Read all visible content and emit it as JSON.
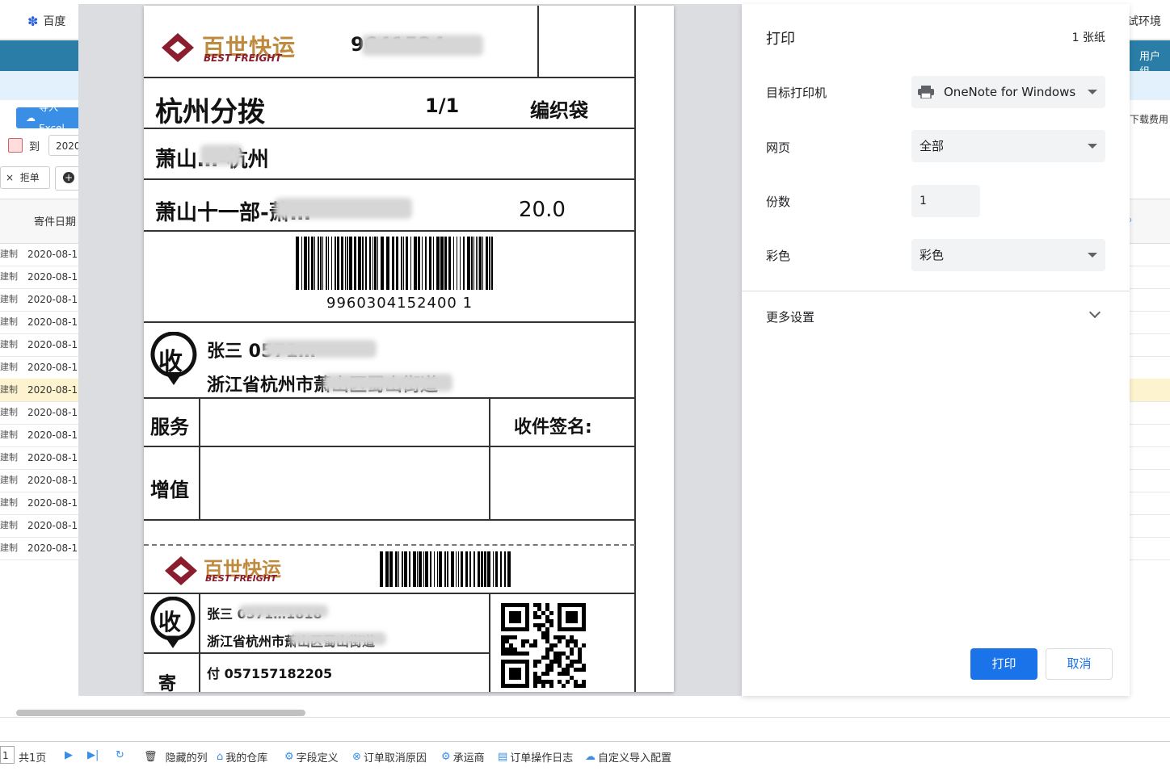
{
  "background_app": {
    "tab_left": "百度",
    "tab_right": "试环境",
    "banner_user": "用户组",
    "import_button": "导入Excel",
    "date_to": "到",
    "date_value": "2020",
    "reject_button": "拒单",
    "right_link": "下载费用",
    "column_title": "寄件日期",
    "rows": [
      {
        "tag": "建制",
        "date": "2020-08-12"
      },
      {
        "tag": "建制",
        "date": "2020-08-12"
      },
      {
        "tag": "建制",
        "date": "2020-08-12"
      },
      {
        "tag": "建制",
        "date": "2020-08-12"
      },
      {
        "tag": "建制",
        "date": "2020-08-12"
      },
      {
        "tag": "建制",
        "date": "2020-08-12"
      },
      {
        "tag": "建制",
        "date": "2020-08-12"
      },
      {
        "tag": "建制",
        "date": "2020-08-12"
      },
      {
        "tag": "建制",
        "date": "2020-08-12"
      },
      {
        "tag": "建制",
        "date": "2020-08-12"
      },
      {
        "tag": "建制",
        "date": "2020-08-12"
      },
      {
        "tag": "建制",
        "date": "2020-08-12"
      },
      {
        "tag": "建制",
        "date": "2020-08-12"
      },
      {
        "tag": "建制",
        "date": "2020-08-12"
      }
    ],
    "highlighted_row_index": 6,
    "bottom_bar": {
      "page_input": "1",
      "total_pages": "共1页",
      "items": [
        "隐藏的列",
        "我的仓库",
        "字段定义",
        "订单取消原因",
        "承运商",
        "订单操作日志",
        "自定义导入配置"
      ]
    }
  },
  "label": {
    "brand_cn": "百世快运",
    "brand_en": "BEST FREIGHT",
    "tracking_top": "9641524",
    "hub": "杭州分拨",
    "piece": "1/1",
    "packaging": "编织袋",
    "route": "萧山…-杭州",
    "dept_line": "萧山十一部-萧…",
    "weight": "20.0",
    "barcode_number": "9960304152400 1",
    "receiver_badge": "收",
    "receiver_name": "张三 0571…",
    "receiver_address": "浙江省杭州市萧山区蜀山街道",
    "service_label": "服务",
    "signature_label": "收件签名:",
    "value_added_label": "增值",
    "receiver_name_small": "张三 0571…1818",
    "receiver_address_small": "浙江省杭州市萧山区蜀山街道",
    "sender_badge": "寄",
    "sender_phone": "付 057157182205"
  },
  "print_dialog": {
    "title": "打印",
    "sheets": "1 张纸",
    "printer_label": "目标打印机",
    "printer_value": "OneNote for Windows",
    "pages_label": "网页",
    "pages_value": "全部",
    "copies_label": "份数",
    "copies_value": "1",
    "color_label": "彩色",
    "color_value": "彩色",
    "more_settings": "更多设置",
    "print_button": "打印",
    "cancel_button": "取消"
  }
}
